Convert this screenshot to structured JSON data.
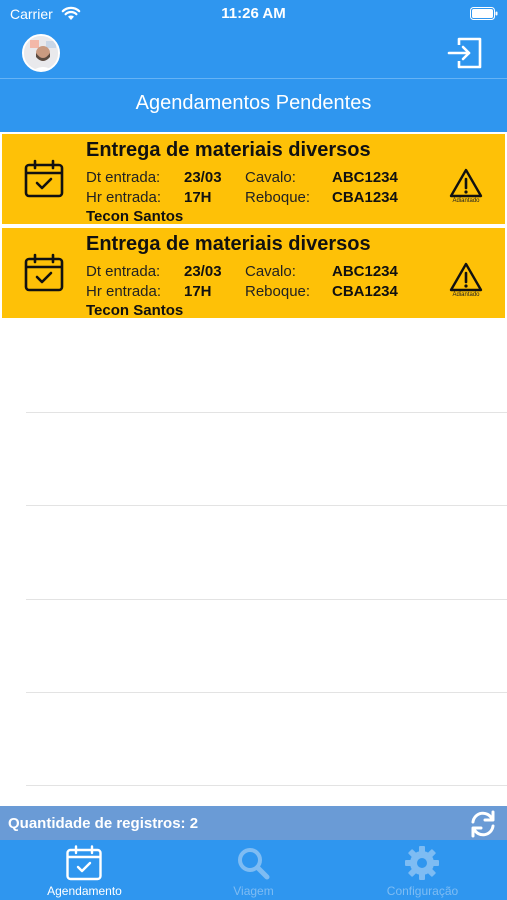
{
  "status_bar": {
    "carrier": "Carrier",
    "time": "11:26 AM"
  },
  "header": {
    "title": "Agendamentos Pendentes"
  },
  "labels": {
    "dt_entrada": "Dt entrada:",
    "hr_entrada": "Hr entrada:",
    "cavalo": "Cavalo:",
    "reboque": "Reboque:"
  },
  "appointments": [
    {
      "title": "Entrega de materiais diversos",
      "dt_entrada": "23/03",
      "hr_entrada": "17H",
      "cavalo": "ABC1234",
      "reboque": "CBA1234",
      "location": "Tecon Santos",
      "status": "Adiantado"
    },
    {
      "title": "Entrega de materiais diversos",
      "dt_entrada": "23/03",
      "hr_entrada": "17H",
      "cavalo": "ABC1234",
      "reboque": "CBA1234",
      "location": "Tecon Santos",
      "status": "Adiantado"
    }
  ],
  "footer": {
    "count_text": "Quantidade de registros: 2"
  },
  "tabs": [
    {
      "label": "Agendamento",
      "icon": "calendar-check-icon",
      "active": true
    },
    {
      "label": "Viagem",
      "icon": "search-icon",
      "active": false
    },
    {
      "label": "Configuração",
      "icon": "gear-icon",
      "active": false
    }
  ],
  "colors": {
    "primary": "#2f96ef",
    "card": "#fec107",
    "count_bar": "#6a9bd6",
    "tab_inactive": "#7ebcf3"
  }
}
